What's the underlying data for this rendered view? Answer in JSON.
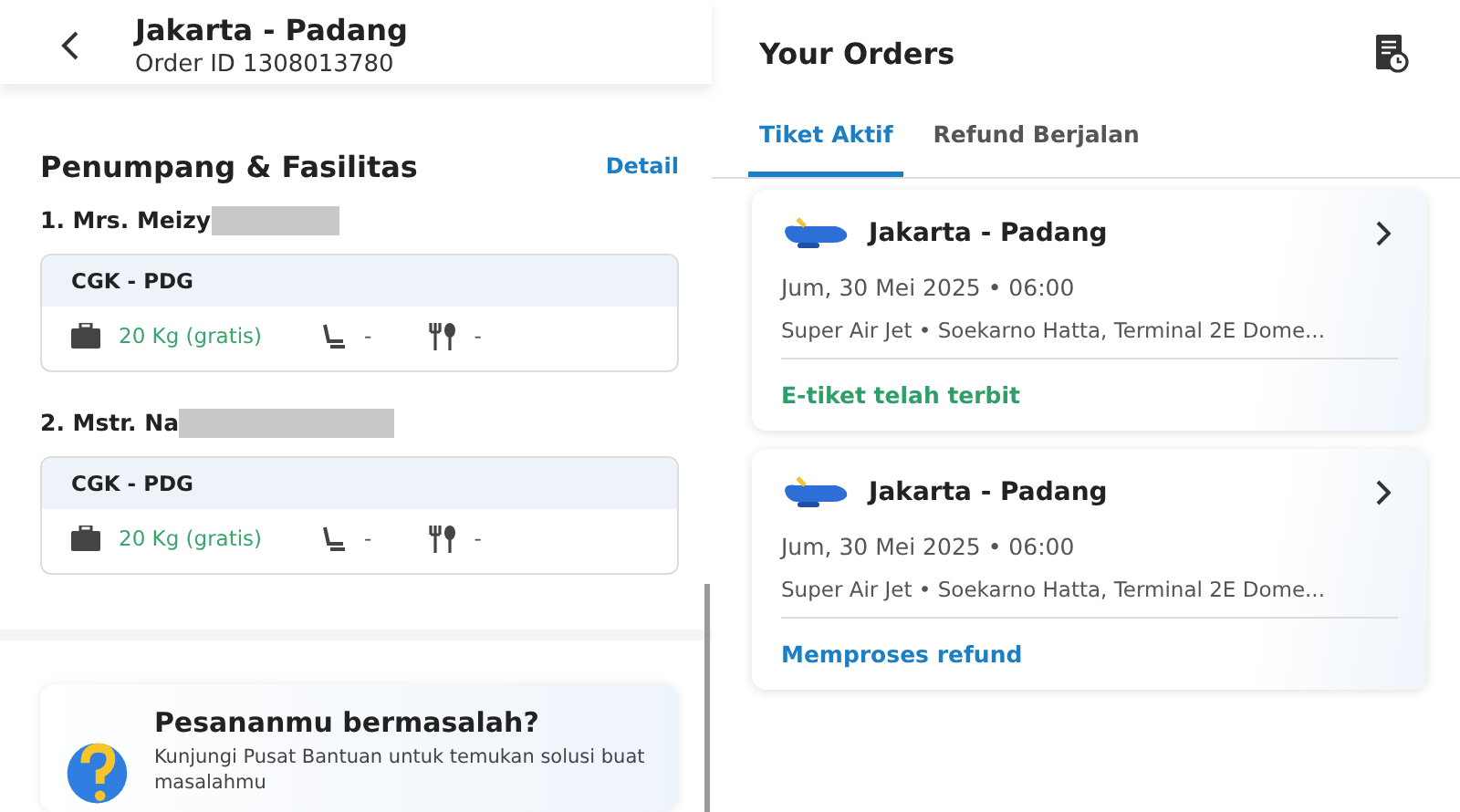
{
  "detail_screen": {
    "title": "Jakarta - Padang",
    "subtitle": "Order ID 1308013780",
    "section_title": "Penumpang & Fasilitas",
    "detail_link": "Detail",
    "passengers": [
      {
        "name": "1. Mrs. Meizy",
        "redacted": true,
        "route": "CGK - PDG",
        "baggage": "20 Kg (gratis)",
        "seat": "-",
        "meal": "-"
      },
      {
        "name": "2. Mstr. Na",
        "redacted": true,
        "route": "CGK - PDG",
        "baggage": "20 Kg (gratis)",
        "seat": "-",
        "meal": "-"
      }
    ],
    "help_card": {
      "title": "Pesananmu bermasalah?",
      "text": "Kunjungi Pusat Bantuan untuk temukan solusi buat masalahmu"
    }
  },
  "orders_screen": {
    "title": "Your Orders",
    "tabs": [
      {
        "label": "Tiket Aktif",
        "selected": true
      },
      {
        "label": "Refund Berjalan",
        "selected": false
      }
    ],
    "orders": [
      {
        "route": "Jakarta - Padang",
        "date": "Jum, 30 Mei 2025 • 06:00",
        "details": "Super Air Jet • Soekarno Hatta, Terminal 2E Dome...",
        "status": "E-tiket telah terbit",
        "kind": "issued"
      },
      {
        "route": "Jakarta - Padang",
        "date": "Jum, 30 Mei 2025 • 06:00",
        "details": "Super Air Jet • Soekarno Hatta, Terminal 2E Dome...",
        "status": "Memproses refund",
        "kind": "refund"
      }
    ]
  }
}
